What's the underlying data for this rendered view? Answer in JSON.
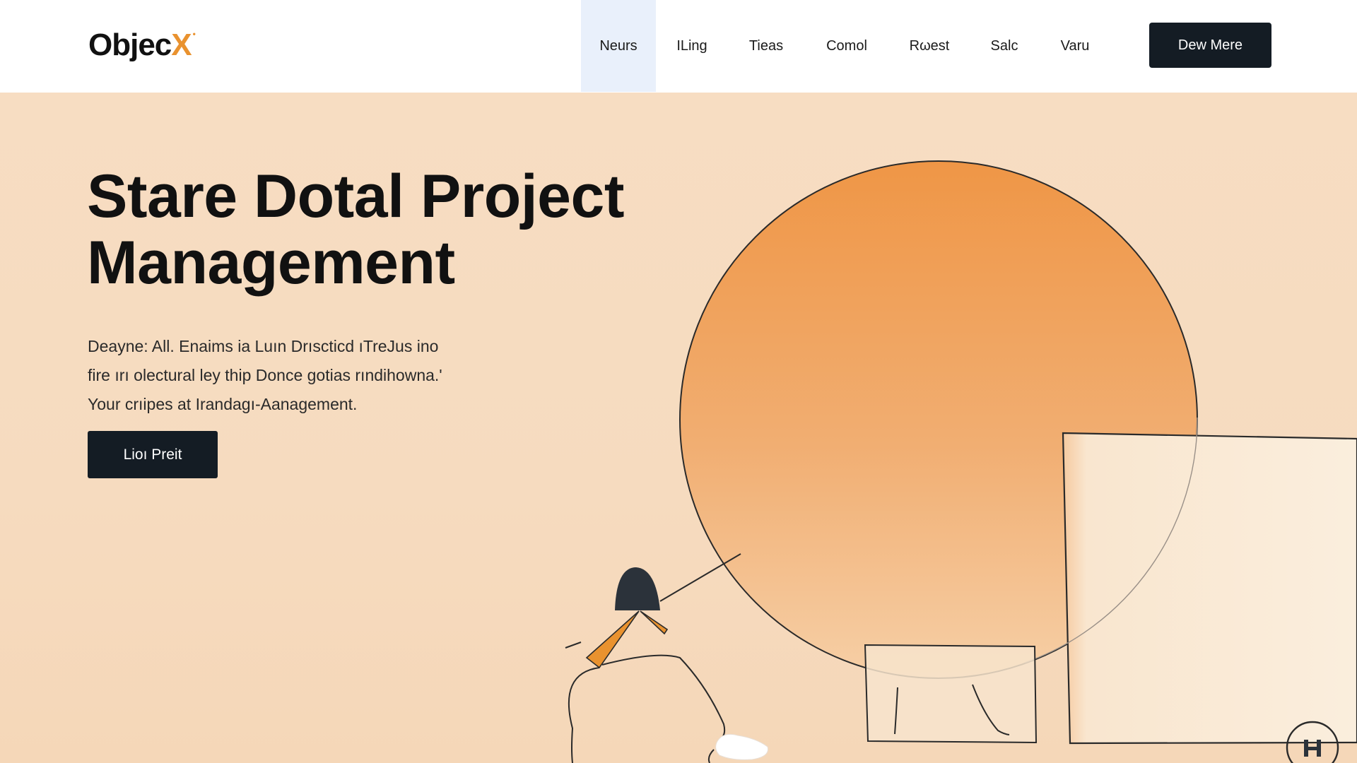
{
  "header": {
    "logo_text": "Objec",
    "logo_accent": "X",
    "nav": [
      {
        "label": "Neurs",
        "active": true
      },
      {
        "label": "ILing",
        "active": false
      },
      {
        "label": "Tieas",
        "active": false
      },
      {
        "label": "Comol",
        "active": false
      },
      {
        "label": "Rωest",
        "active": false
      },
      {
        "label": "Salc",
        "active": false
      },
      {
        "label": "Varu",
        "active": false
      }
    ],
    "cta_label": "Dew Mere"
  },
  "hero": {
    "title_line1": "Stare Dotal Project",
    "title_line2": "Management",
    "desc_lines": [
      "Deayne: All. Enaims ia Luın Drıscticd ıTreJus ino",
      "fire ırı olectural ley thip Donce gotias rındihowna.'",
      "Your crıipes at Irandagı-Aanagement."
    ],
    "cta_label": "Lioı Preit"
  },
  "colors": {
    "accent": "#e9922f",
    "hero_bg": "#f7ddc2",
    "button_bg": "#141c24",
    "nav_active_bg": "#e9f0fb",
    "circle_top": "#ef9a4f",
    "circle_bottom": "#f5c595"
  },
  "icons": {
    "corner_badge": "h-badge-icon"
  }
}
